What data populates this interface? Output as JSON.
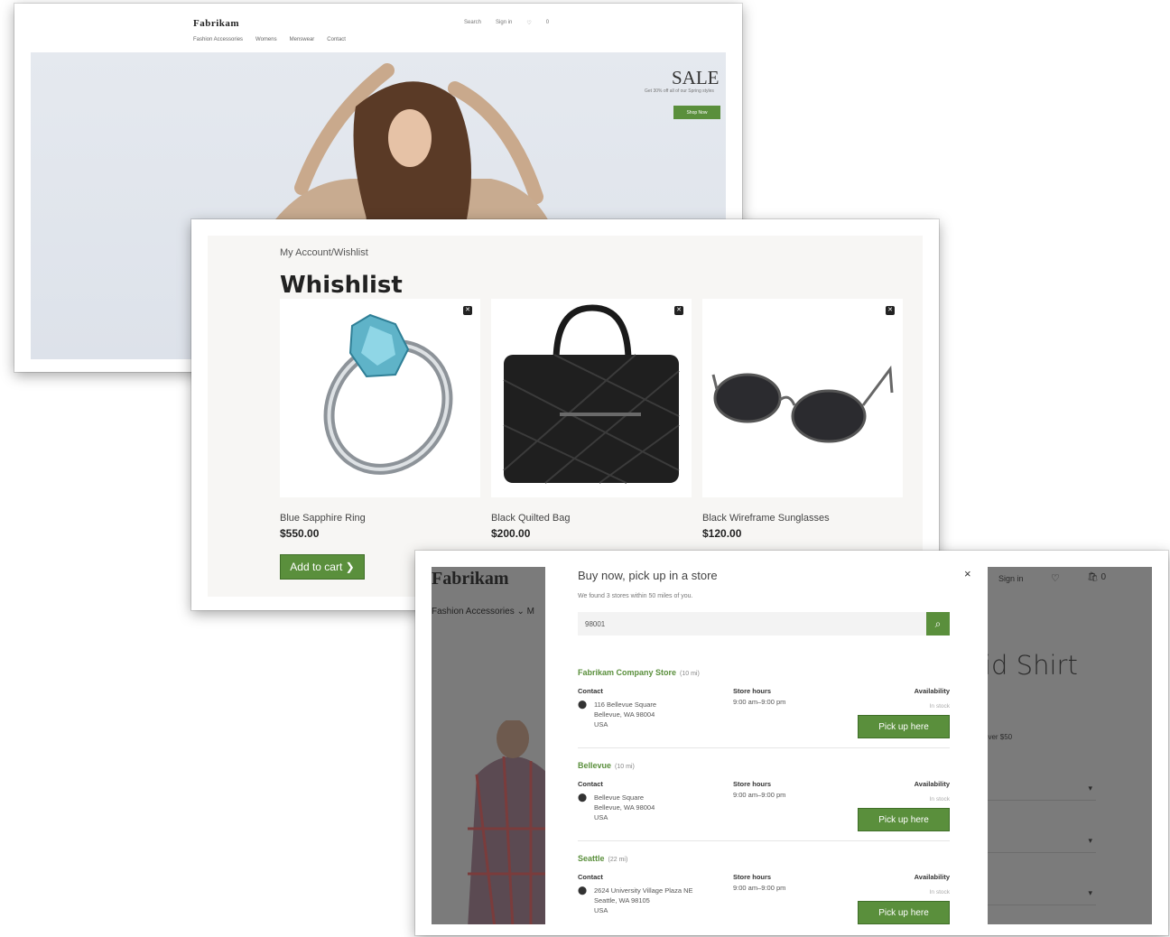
{
  "home": {
    "logo": "Fabrikam",
    "nav": [
      "Fashion Accessories",
      "Womens",
      "Menswear",
      "Contact"
    ],
    "utility": [
      "Search",
      "Sign in",
      "♡",
      "0"
    ],
    "sale_title": "SALE",
    "sale_subtitle": "Get 30% off all of our Spring styles",
    "sale_button": "Shop Now"
  },
  "wishlist": {
    "breadcrumb": "My Account/Wishlist",
    "title": "Whishlist",
    "items": [
      {
        "name": "Blue Sapphire Ring",
        "price": "$550.00"
      },
      {
        "name": "Black Quilted Bag",
        "price": "$200.00"
      },
      {
        "name": "Black Wireframe Sunglasses",
        "price": "$120.00"
      }
    ],
    "add_to_cart": "Add to cart ❯",
    "remove_icon": "✕"
  },
  "pickup": {
    "background": {
      "logo": "Fabrikam",
      "nav": "Fashion Accessories ⌄   M",
      "sign_in": "Sign in",
      "cart_count": "0",
      "product_title": "id Shirt",
      "shipping_note": "over $50"
    },
    "dialog": {
      "title": "Buy now, pick up in a store",
      "close": "×",
      "subtitle": "We found 3 stores within 50 miles of you.",
      "search_value": "98001",
      "stores": [
        {
          "name": "Fabrikam Company Store",
          "distance": "(10 mi)",
          "contact_label": "Contact",
          "address": [
            "116 Bellevue Square",
            "Bellevue, WA 98004",
            "USA"
          ],
          "hours_label": "Store hours",
          "hours": "9:00 am–9:00 pm",
          "availability_label": "Availability",
          "availability": "In stock",
          "button": "Pick up here"
        },
        {
          "name": "Bellevue",
          "distance": "(10 mi)",
          "contact_label": "Contact",
          "address": [
            "Bellevue Square",
            "Bellevue, WA 98004",
            "USA"
          ],
          "hours_label": "Store hours",
          "hours": "9:00 am–9:00 pm",
          "availability_label": "Availability",
          "availability": "In stock",
          "button": "Pick up here"
        },
        {
          "name": "Seattle",
          "distance": "(22 mi)",
          "contact_label": "Contact",
          "address": [
            "2624 University Village Plaza NE",
            "Seattle, WA 98105",
            "USA"
          ],
          "hours_label": "Store hours",
          "hours": "9:00 am–9:00 pm",
          "availability_label": "Availability",
          "availability": "In stock",
          "button": "Pick up here"
        }
      ]
    }
  },
  "colors": {
    "accent": "#5a8f3c",
    "overlay": "#7b7b7b"
  }
}
